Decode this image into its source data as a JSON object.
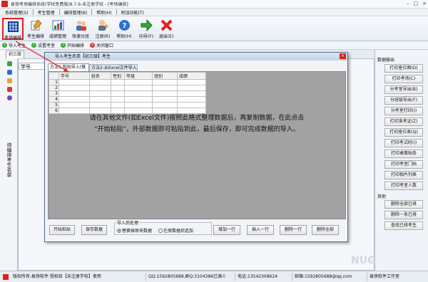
{
  "window": {
    "title": "易快考场编排系统(学校免费版)8.7.9-未注册学校 - [考场编排]"
  },
  "menu": [
    "系统管理(S)",
    "考生管理",
    "编排管理(B)",
    "帮助(H)",
    "附加功能(T)"
  ],
  "toolbar": [
    {
      "label": "考场编排",
      "icon": "grid-icon"
    },
    {
      "label": "考生编排",
      "icon": "pencil-icon"
    },
    {
      "label": "成绩管理",
      "icon": "chart-icon"
    },
    {
      "label": "快速分班",
      "icon": "users-icon"
    },
    {
      "label": "注册(R)",
      "icon": "register-icon"
    },
    {
      "label": "帮助(H)",
      "icon": "help-icon"
    },
    {
      "label": "向导(F)",
      "icon": "arrow-icon"
    },
    {
      "label": "退出(E)",
      "icon": "exit-icon"
    }
  ],
  "subbar": [
    "导入考生",
    "设置考室",
    "开始编排",
    "关闭窗口"
  ],
  "left": {
    "tab": "初三级",
    "column_header": "学号",
    "vertical_label": "待编排考生名单"
  },
  "right": {
    "group1": "数据输出",
    "buttons1": [
      "打印座位图(D)",
      "打印考场(C)",
      "分考室导出(B)",
      "分班级导出(F)",
      "分考室打印(I)",
      "打印准考证(Z)",
      "打印座位表(Q)",
      "打印考试时(I)",
      "打印桌面贴条",
      "打印考室门贴",
      "打印相片列表",
      "打印考室人数"
    ],
    "group2": "其他",
    "buttons2": [
      "删除全部已排",
      "删除一条已排",
      "查找已排考生"
    ]
  },
  "dialog": {
    "title": "导入考生名单【初三级】考生",
    "tab1": "方法1:粘贴导入(推荐)",
    "tab2": "方法2:从Excel文件导入",
    "columns": [
      "学号",
      "姓名",
      "性别",
      "年级",
      "班别",
      "成绩"
    ],
    "rows": [
      "1",
      "2",
      "3",
      "4",
      "5",
      "6"
    ],
    "instruction_line1": "请在其他文件(如Excel文件)按照此格式整理数据后，再复制数据，在此点击",
    "instruction_line2": "\"开始粘贴\"，外部数据即可粘贴到此，最后保存，即可完成数据的导入。",
    "btn_paste": "开始粘贴",
    "btn_save": "保存数据",
    "import_group_label": "导入后处理",
    "radio1": "替换掉原来数据",
    "radio2": "在原数据后追加",
    "btn_add": "增加一行",
    "btn_insert": "插入一行",
    "btn_delete": "删除一行",
    "btn_delete_all": "删除全部"
  },
  "status": [
    "版权所有:易快软件 授权给【未注册学校】使用",
    "QQ:1592805688,群Q:3104386已满人",
    "电话:13542308624",
    "邮箱:1592805688@qq.com",
    "易快软件工作室"
  ],
  "watermark": "NUG"
}
